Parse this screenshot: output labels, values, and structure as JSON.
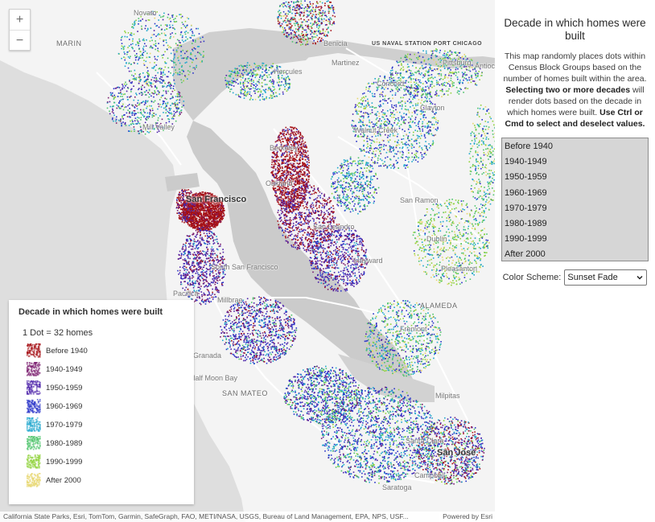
{
  "map": {
    "places": {
      "novato": "Novato",
      "marin": "MARIN",
      "mill_valley": "Mill Valley",
      "san_francisco": "San Francisco",
      "south_san_francisco": "South San Francisco",
      "pacifica": "Pacifica",
      "millbrae": "Millbrae",
      "half_moon_bay": "Half Moon Bay",
      "granada": "Granada",
      "san_mateo": "SAN MATEO",
      "benicia": "Benicia",
      "navy": "US NAVAL STATION PORT CHICAGO",
      "pittsburg": "Pittsburg",
      "antioch": "Antioch",
      "martinez": "Martinez",
      "hercules": "Hercules",
      "concord": "Concord",
      "clayton": "Clayton",
      "walnut_creek": "Walnut Creek",
      "berkeley": "Berkeley",
      "oakland": "Oakland",
      "san_ramon": "San Ramon",
      "san_leandro": "San Leandro",
      "dublin": "Dublin",
      "hayward": "Hayward",
      "pleasanton": "Pleasanton",
      "alameda": "ALAMEDA",
      "fremont": "Fremont",
      "milpitas": "Milpitas",
      "santa_clara": "Santa Clara",
      "san_jose": "San Jose",
      "campbell": "Campbell",
      "saratoga": "Saratoga"
    },
    "zoom_in": "+",
    "zoom_out": "−",
    "attribution": "California State Parks, Esri, TomTom, Garmin, SafeGraph, FAO, METI/NASA, USGS, Bureau of Land Management, EPA, NPS, USF...",
    "powered_by": "Powered by Esri"
  },
  "legend": {
    "title": "Decade in which homes were built",
    "subtitle": "1 Dot = 32 homes",
    "items": [
      {
        "label": "Before 1940",
        "color": "#a50f15"
      },
      {
        "label": "1940-1949",
        "color": "#7a1d6e"
      },
      {
        "label": "1950-1959",
        "color": "#4a1fa8"
      },
      {
        "label": "1960-1969",
        "color": "#2832c8"
      },
      {
        "label": "1970-1979",
        "color": "#1fa6cc"
      },
      {
        "label": "1980-1989",
        "color": "#4cc36a"
      },
      {
        "label": "1990-1999",
        "color": "#8fd23a"
      },
      {
        "label": "After 2000",
        "color": "#e7d56a"
      }
    ]
  },
  "panel": {
    "title": "Decade in which homes were built",
    "desc_part1": "This map randomly places dots within Census Block Groups based on the number of homes built within the area. ",
    "desc_bold1": "Selecting two or more decades",
    "desc_part2": " will render dots based on the decade in which homes were built. ",
    "desc_bold2": "Use Ctrl or Cmd to select and deselect values.",
    "decades": [
      "Before 1940",
      "1940-1949",
      "1950-1959",
      "1960-1969",
      "1970-1979",
      "1980-1989",
      "1990-1999",
      "After 2000"
    ],
    "scheme_label": "Color Scheme:",
    "scheme_value": "Sunset Fade",
    "colors": {
      "land": "#f4f4f4",
      "water": "#c9c9c9",
      "ocean": "#e0e0e0"
    }
  }
}
